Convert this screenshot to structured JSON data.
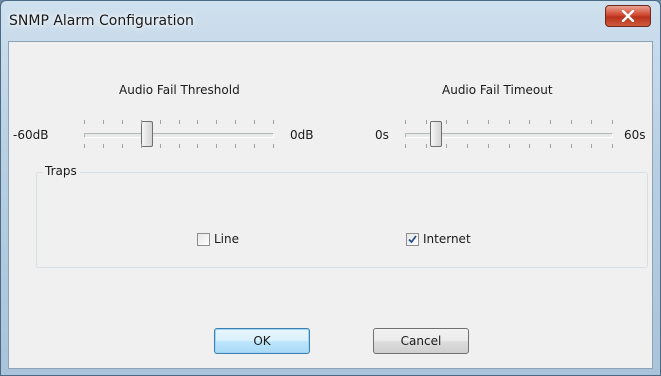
{
  "window": {
    "title": "SNMP Alarm Configuration",
    "close_icon": "close-x-icon"
  },
  "threshold": {
    "label": "Audio Fail Threshold",
    "min_label": "-60dB",
    "max_label": "0dB",
    "value_fraction": 0.33
  },
  "timeout": {
    "label": "Audio Fail Timeout",
    "min_label": "0s",
    "max_label": "60s",
    "value_fraction": 0.15
  },
  "traps": {
    "caption": "Traps",
    "line": {
      "label": "Line",
      "checked": false
    },
    "internet": {
      "label": "Internet",
      "checked": true
    }
  },
  "buttons": {
    "ok": "OK",
    "cancel": "Cancel"
  },
  "colors": {
    "accent": "#3c7fb1",
    "close": "#c8452c"
  }
}
